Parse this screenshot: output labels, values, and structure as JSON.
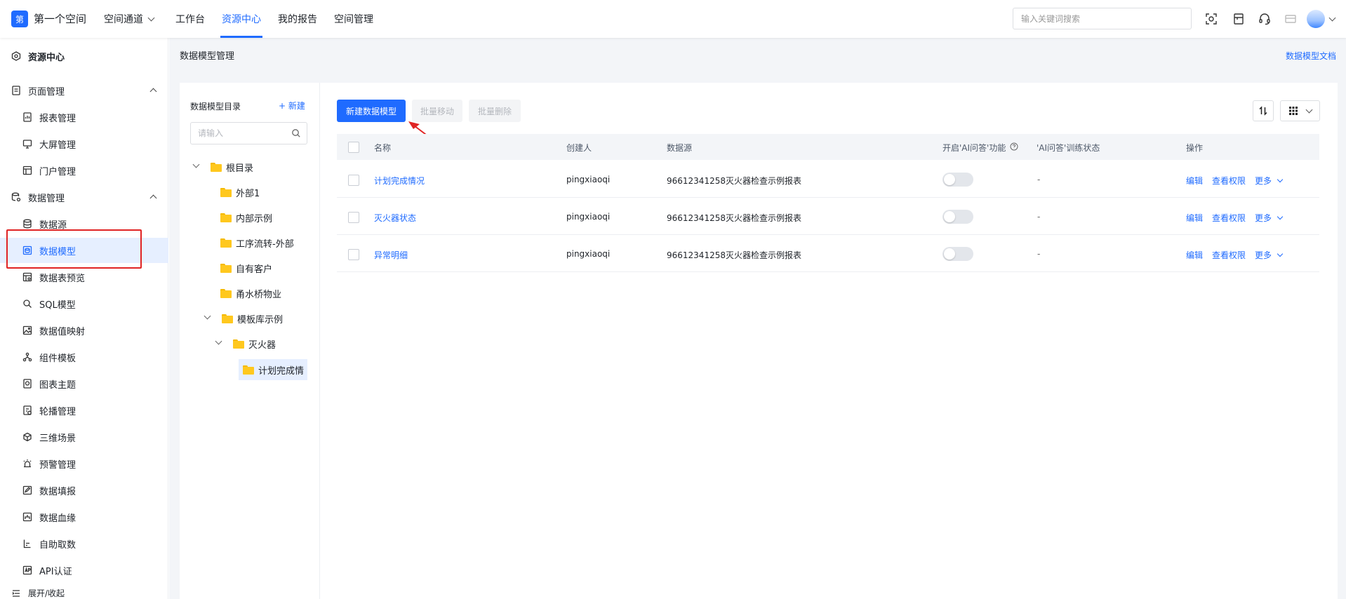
{
  "header": {
    "logo_char": "第",
    "space_name": "第一个空间",
    "nav": [
      "空间通道",
      "工作台",
      "资源中心",
      "我的报告",
      "空间管理"
    ],
    "active_nav": "资源中心",
    "search_placeholder": "输入关键词搜索",
    "icons": [
      "scan-icon",
      "document-icon",
      "headset-icon",
      "card-icon",
      "avatar"
    ]
  },
  "sidebar": {
    "title": "资源中心",
    "groups": [
      {
        "label": "页面管理",
        "items": [
          "报表管理",
          "大屏管理",
          "门户管理"
        ]
      },
      {
        "label": "数据管理",
        "items": [
          "数据源",
          "数据模型",
          "数据表预览",
          "SQL模型",
          "数据值映射",
          "组件模板",
          "图表主题",
          "轮播管理",
          "三维场景",
          "预警管理",
          "数据填报",
          "数据血缘",
          "自助取数",
          "API认证"
        ]
      }
    ],
    "selected": "数据模型",
    "footer": "展开/收起"
  },
  "page": {
    "breadcrumb": "数据模型管理",
    "doc_link": "数据模型文档"
  },
  "tree": {
    "title": "数据模型目录",
    "new_label": "+ 新建",
    "search_placeholder": "请输入",
    "nodes": [
      "根目录",
      "外部1",
      "内部示例",
      "工序流转-外部",
      "自有客户",
      "甬水桥物业",
      "模板库示例",
      "灭火器",
      "计划完成情"
    ]
  },
  "toolbar": {
    "new_model": "新建数据模型",
    "batch_move": "批量移动",
    "batch_delete": "批量删除"
  },
  "table": {
    "headers": [
      "名称",
      "创建人",
      "数据源",
      "开启'AI问答'功能",
      "'AI问答'训练状态",
      "操作"
    ],
    "rows": [
      {
        "name": "计划完成情况",
        "creator": "pingxiaoqi",
        "source": "96612341258灭火器检查示例报表",
        "ai_enabled": false,
        "train_status": "-"
      },
      {
        "name": "灭火器状态",
        "creator": "pingxiaoqi",
        "source": "96612341258灭火器检查示例报表",
        "ai_enabled": false,
        "train_status": "-"
      },
      {
        "name": "异常明细",
        "creator": "pingxiaoqi",
        "source": "96612341258灭火器检查示例报表",
        "ai_enabled": false,
        "train_status": "-"
      }
    ],
    "actions": {
      "edit": "编辑",
      "permissions": "查看权限",
      "more": "更多"
    }
  },
  "colors": {
    "accent": "#1f6bff",
    "annotation": "#e02424",
    "folder": "#ffc81e"
  }
}
